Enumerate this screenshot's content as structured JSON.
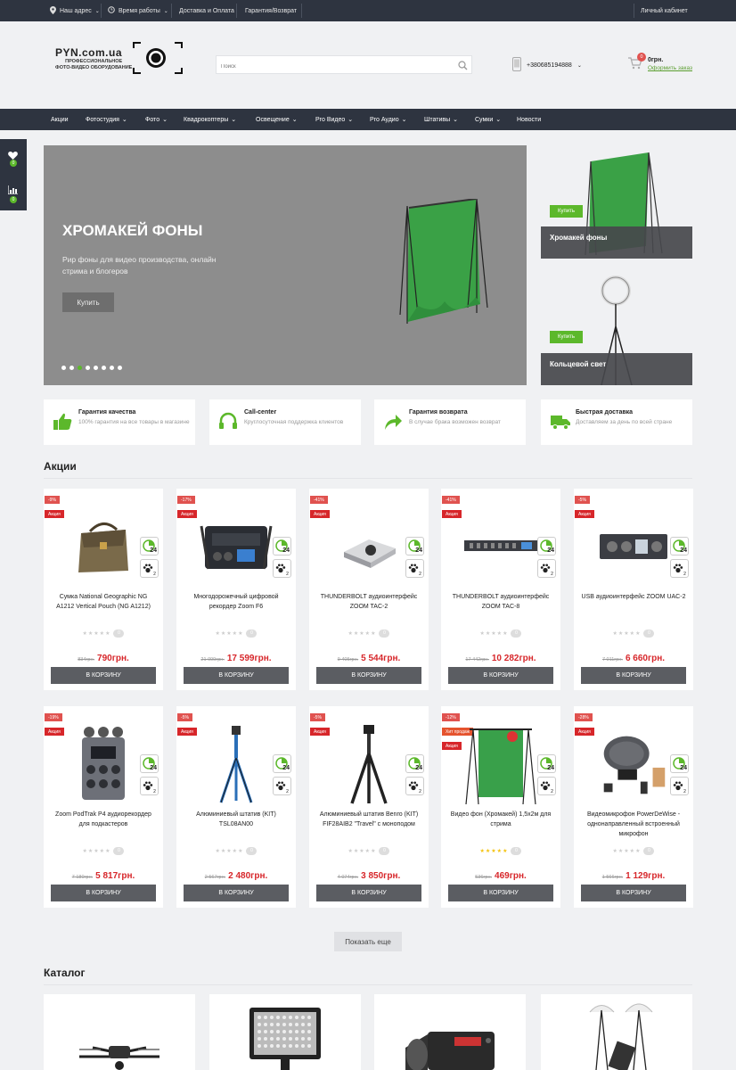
{
  "topbar": {
    "address": "Наш адрес",
    "hours": "Время работы",
    "delivery": "Доставка и Оплата",
    "warranty": "Гарантия/Возврат",
    "account": "Личный кабинет"
  },
  "header": {
    "logo_name": "PYN.com.ua",
    "logo_sub1": "ПРОФЕССИОНАЛЬНОЕ",
    "logo_sub2": "ФОТО-ВИДЕО ОБОРУДОВАНИЕ",
    "search_placeholder": "Поиск",
    "phone": "+380685194888",
    "cart_total": "0грн.",
    "cart_count": "0",
    "checkout": "Оформить заказ"
  },
  "nav": [
    {
      "label": "Акции",
      "dropdown": false
    },
    {
      "label": "Фотостудия",
      "dropdown": true
    },
    {
      "label": "Фото",
      "dropdown": true
    },
    {
      "label": "Квадрокоптеры",
      "dropdown": true
    },
    {
      "label": "Освещение",
      "dropdown": true
    },
    {
      "label": "Pro Видео",
      "dropdown": true
    },
    {
      "label": "Pro Аудио",
      "dropdown": true
    },
    {
      "label": "Штативы",
      "dropdown": true
    },
    {
      "label": "Сумки",
      "dropdown": true
    },
    {
      "label": "Новости",
      "dropdown": false
    }
  ],
  "sidewidget": {
    "wishlist_count": "0",
    "compare_count": "0"
  },
  "banner": {
    "title": "ХРОМАКЕЙ ФОНЫ",
    "text": "Рир фоны для видео производства, онлайн стрима и блогеров",
    "button": "Купить",
    "slides": 8,
    "active_slide": 3
  },
  "side_promos": [
    {
      "caption": "Хромакей фоны",
      "button": "Купить"
    },
    {
      "caption": "Кольцевой свет",
      "button": "Купить"
    }
  ],
  "features": [
    {
      "title": "Гарантия качества",
      "desc": "100% гарантия на все товары в магазине",
      "icon": "thumbs-up-icon"
    },
    {
      "title": "Call-center",
      "desc": "Круглосуточная поддержка клиентов",
      "icon": "headset-icon"
    },
    {
      "title": "Гарантия возврата",
      "desc": "В случае брака возможен возврат",
      "icon": "return-arrow-icon"
    },
    {
      "title": "Быстрая доставка",
      "desc": "Доставляем за день по всей стране",
      "icon": "truck-icon"
    }
  ],
  "sections": {
    "promo_title": "Акции",
    "catalog_title": "Каталог",
    "show_more": "Показать еще"
  },
  "product_rows": [
    [
      {
        "discount": "-9%",
        "label": "Акция",
        "label2": "",
        "name": "Сумка National Geographic NG A1212 Vertical Pouch (NG A1212)",
        "old_price": "834грн.",
        "price": "790грн.",
        "reviews": "0",
        "rating": 0,
        "cart": "В КОРЗИНУ",
        "badge24": "24",
        "badge2": "2",
        "image": "bag"
      },
      {
        "discount": "-17%",
        "label": "Акция",
        "label2": "",
        "name": "Многодорожечный цифровой рекордер Zoom F6",
        "old_price": "21 099грн.",
        "price": "17 599грн.",
        "reviews": "0",
        "rating": 0,
        "cart": "В КОРЗИНУ",
        "badge24": "24",
        "badge2": "2",
        "image": "recorder"
      },
      {
        "discount": "-41%",
        "label": "Акция",
        "label2": "",
        "name": "THUNDERBOLT аудиоинтерфейс ZOOM TAC-2",
        "old_price": "9 405грн.",
        "price": "5 544грн.",
        "reviews": "0",
        "rating": 0,
        "cart": "В КОРЗИНУ",
        "badge24": "24",
        "badge2": "2",
        "image": "tac2"
      },
      {
        "discount": "-41%",
        "label": "Акция",
        "label2": "",
        "name": "THUNDERBOLT аудиоинтерфейс ZOOM TAC-8",
        "old_price": "17 442грн.",
        "price": "10 282грн.",
        "reviews": "0",
        "rating": 0,
        "cart": "В КОРЗИНУ",
        "badge24": "24",
        "badge2": "2",
        "image": "tac8"
      },
      {
        "discount": "-5%",
        "label": "Акция",
        "label2": "",
        "name": "USB аудиоинтерфейс ZOOM UAC-2",
        "old_price": "7 011грн.",
        "price": "6 660грн.",
        "reviews": "0",
        "rating": 0,
        "cart": "В КОРЗИНУ",
        "badge24": "24",
        "badge2": "2",
        "image": "uac2"
      }
    ],
    [
      {
        "discount": "-19%",
        "label": "Акция",
        "label2": "",
        "name": "Zoom PodTrak P4 аудиорекордер для подкастеров",
        "old_price": "7 180грн.",
        "price": "5 817грн.",
        "reviews": "0",
        "rating": 0,
        "cart": "В КОРЗИНУ",
        "badge24": "24",
        "badge2": "2",
        "image": "podtrak"
      },
      {
        "discount": "-5%",
        "label": "Акция",
        "label2": "",
        "name": "Алюминиевый штатив (KIT) TSL08AN00",
        "old_price": "2 567грн.",
        "price": "2 480грн.",
        "reviews": "0",
        "rating": 0,
        "cart": "В КОРЗИНУ",
        "badge24": "24",
        "badge2": "2",
        "image": "tripod-blue"
      },
      {
        "discount": "-5%",
        "label": "Акция",
        "label2": "",
        "name": "Алюминиевый штатив Benro (KIT) FIF28AIB2 \"Travel\" с моноподом",
        "old_price": "4 074грн.",
        "price": "3 850грн.",
        "reviews": "0",
        "rating": 0,
        "cart": "В КОРЗИНУ",
        "badge24": "24",
        "badge2": "2",
        "image": "tripod-black"
      },
      {
        "discount": "-12%",
        "label": "Хит продаж",
        "label2": "Акция",
        "name": "Видео фон (Хромакей) 1,5х2м для стрима",
        "old_price": "536грн.",
        "price": "469грн.",
        "reviews": "0",
        "rating": 5,
        "cart": "В КОРЗИНУ",
        "badge24": "24",
        "badge2": "2",
        "image": "greenscreen"
      },
      {
        "discount": "-28%",
        "label": "Акция",
        "label2": "",
        "name": "Видеомикрофон PowerDeWise - однонаправленный встроенный микрофон",
        "old_price": "1 566грн.",
        "price": "1 129грн.",
        "reviews": "0",
        "rating": 0,
        "cart": "В КОРЗИНУ",
        "badge24": "24",
        "badge2": "2",
        "image": "mic"
      }
    ]
  ]
}
